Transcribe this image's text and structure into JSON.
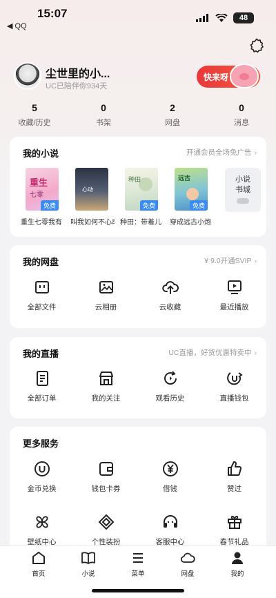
{
  "status_bar": {
    "time": "15:07",
    "back_app": "◀ QQ",
    "battery": "48"
  },
  "profile": {
    "username": "尘世里的小...",
    "companion_text": "UC已陪伴你934天",
    "promo_label": "快来呀"
  },
  "stats": [
    {
      "value": "5",
      "label": "收藏/历史"
    },
    {
      "value": "0",
      "label": "书架"
    },
    {
      "value": "2",
      "label": "网盘"
    },
    {
      "value": "0",
      "label": "消息"
    }
  ],
  "novels_section": {
    "title": "我的小说",
    "link": "开通会员全场免广告",
    "items": [
      {
        "title": "重生七零我有",
        "badge": "免费"
      },
      {
        "title": "叫我如何不心动",
        "badge": ""
      },
      {
        "title": "种田：带着儿",
        "badge": "免费"
      },
      {
        "title": "穿成远古小炮",
        "badge": "免费"
      }
    ],
    "store_label_line1": "小说",
    "store_label_line2": "书城"
  },
  "cloud_section": {
    "title": "我的网盘",
    "link": "¥ 9.0开通SVIP",
    "items": [
      {
        "label": "全部文件",
        "icon": "folder-icon"
      },
      {
        "label": "云相册",
        "icon": "image-icon"
      },
      {
        "label": "云收藏",
        "icon": "cloud-upload-icon"
      },
      {
        "label": "最近播放",
        "icon": "play-monitor-icon"
      }
    ]
  },
  "live_section": {
    "title": "我的直播",
    "link": "UC直播，好货优惠特卖中",
    "items": [
      {
        "label": "全部订单",
        "icon": "document-icon"
      },
      {
        "label": "我的关注",
        "icon": "shop-icon"
      },
      {
        "label": "观看历史",
        "icon": "history-icon"
      },
      {
        "label": "直播钱包",
        "icon": "wallet-u-icon"
      }
    ]
  },
  "services_section": {
    "title": "更多服务",
    "row1": [
      {
        "label": "金币兑换",
        "icon": "coin-icon"
      },
      {
        "label": "钱包卡券",
        "icon": "wallet-icon"
      },
      {
        "label": "借钱",
        "icon": "yen-icon"
      },
      {
        "label": "赞过",
        "icon": "thumbs-up-icon"
      }
    ],
    "row2": [
      {
        "label": "壁纸中心",
        "icon": "pinwheel-icon"
      },
      {
        "label": "个性装扮",
        "icon": "shape-icon"
      },
      {
        "label": "客服中心",
        "icon": "headset-icon"
      },
      {
        "label": "春节礼品",
        "icon": "gift-icon"
      }
    ]
  },
  "bottom_nav": [
    {
      "label": "首页",
      "icon": "home-icon"
    },
    {
      "label": "小说",
      "icon": "book-icon"
    },
    {
      "label": "菜单",
      "icon": "menu-icon"
    },
    {
      "label": "网盘",
      "icon": "cloud-icon"
    },
    {
      "label": "我的",
      "icon": "person-icon"
    }
  ]
}
